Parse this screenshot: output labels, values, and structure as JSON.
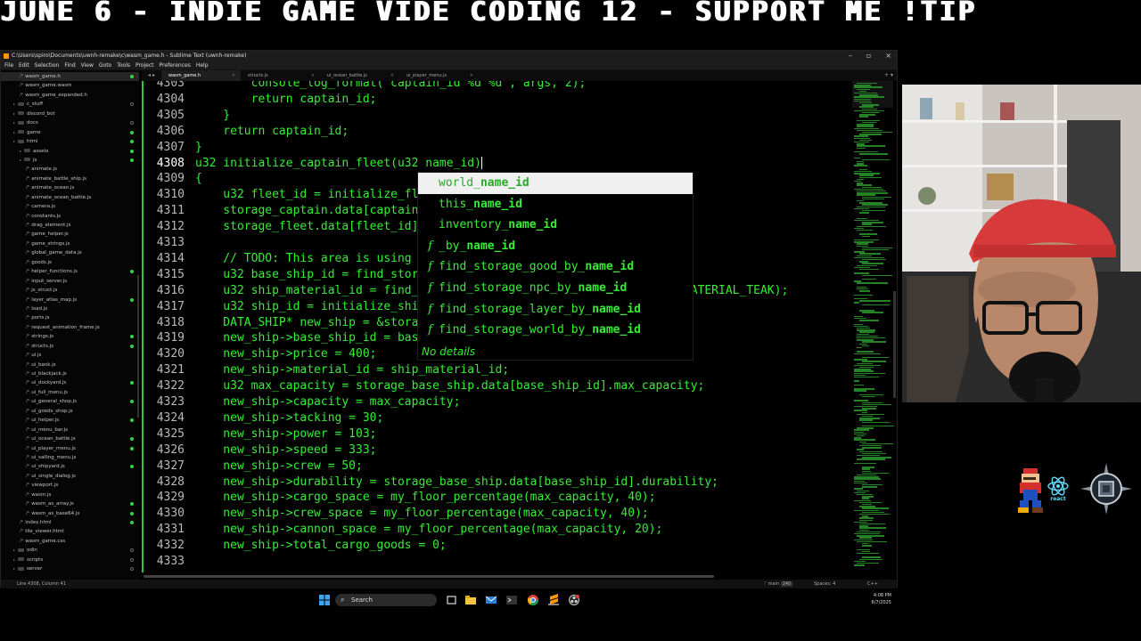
{
  "banner": {
    "text": "JUNE 6 - INDIE GAME VIDE CODING 12 - SUPPORT ME !TIP"
  },
  "window": {
    "title": "C:\\Users\\spiro\\Documents\\uwnh-remake\\c\\wasm_game.h - Sublime Text (uwnh-remake)",
    "controls": [
      "–",
      "▫",
      "×"
    ]
  },
  "menu": [
    "File",
    "Edit",
    "Selection",
    "Find",
    "View",
    "Goto",
    "Tools",
    "Project",
    "Preferences",
    "Help"
  ],
  "sidebar": {
    "items": [
      {
        "label": "wasm_game.h",
        "type": "file",
        "depth": 3,
        "status": "mod",
        "selected": true
      },
      {
        "label": "wasm_game.wasm",
        "type": "file",
        "depth": 3,
        "status": "none"
      },
      {
        "label": "wasm_game_expanded.h",
        "type": "file",
        "depth": 3,
        "status": "none"
      },
      {
        "label": "c_stuff",
        "type": "folder",
        "depth": 2,
        "status": "empty"
      },
      {
        "label": "discord_bot",
        "type": "folder",
        "depth": 2,
        "status": "none"
      },
      {
        "label": "docs",
        "type": "folder",
        "depth": 2,
        "status": "empty"
      },
      {
        "label": "game",
        "type": "folder",
        "depth": 2,
        "status": "mod"
      },
      {
        "label": "html",
        "type": "folder",
        "depth": 2,
        "status": "mod"
      },
      {
        "label": "assets",
        "type": "folder",
        "depth": 3,
        "status": "mod"
      },
      {
        "label": "js",
        "type": "folder",
        "depth": 3,
        "status": "mod"
      },
      {
        "label": "animate.js",
        "type": "file",
        "depth": 4,
        "status": "none"
      },
      {
        "label": "animate_battle_ship.js",
        "type": "file",
        "depth": 4,
        "status": "none"
      },
      {
        "label": "animate_ocean.js",
        "type": "file",
        "depth": 4,
        "status": "none"
      },
      {
        "label": "animate_ocean_battle.js",
        "type": "file",
        "depth": 4,
        "status": "none"
      },
      {
        "label": "camera.js",
        "type": "file",
        "depth": 4,
        "status": "none"
      },
      {
        "label": "constants.js",
        "type": "file",
        "depth": 4,
        "status": "none"
      },
      {
        "label": "drag_element.js",
        "type": "file",
        "depth": 4,
        "status": "none"
      },
      {
        "label": "game_helper.js",
        "type": "file",
        "depth": 4,
        "status": "none"
      },
      {
        "label": "game_strings.js",
        "type": "file",
        "depth": 4,
        "status": "none"
      },
      {
        "label": "global_game_data.js",
        "type": "file",
        "depth": 4,
        "status": "none"
      },
      {
        "label": "goods.js",
        "type": "file",
        "depth": 4,
        "status": "none"
      },
      {
        "label": "helper_functions.js",
        "type": "file",
        "depth": 4,
        "status": "mod"
      },
      {
        "label": "input_server.js",
        "type": "file",
        "depth": 4,
        "status": "none"
      },
      {
        "label": "js_struct.js",
        "type": "file",
        "depth": 4,
        "status": "none"
      },
      {
        "label": "layer_atlas_map.js",
        "type": "file",
        "depth": 4,
        "status": "mod"
      },
      {
        "label": "load.js",
        "type": "file",
        "depth": 4,
        "status": "none"
      },
      {
        "label": "ports.js",
        "type": "file",
        "depth": 4,
        "status": "none"
      },
      {
        "label": "request_animation_frame.js",
        "type": "file",
        "depth": 4,
        "status": "none"
      },
      {
        "label": "strings.js",
        "type": "file",
        "depth": 4,
        "status": "mod"
      },
      {
        "label": "structs.js",
        "type": "file",
        "depth": 4,
        "status": "mod"
      },
      {
        "label": "ui.js",
        "type": "file",
        "depth": 4,
        "status": "none"
      },
      {
        "label": "ui_bank.js",
        "type": "file",
        "depth": 4,
        "status": "none"
      },
      {
        "label": "ui_blackjack.js",
        "type": "file",
        "depth": 4,
        "status": "none"
      },
      {
        "label": "ui_dockyard.js",
        "type": "file",
        "depth": 4,
        "status": "mod"
      },
      {
        "label": "ui_full_menu.js",
        "type": "file",
        "depth": 4,
        "status": "none"
      },
      {
        "label": "ui_general_shop.js",
        "type": "file",
        "depth": 4,
        "status": "mod"
      },
      {
        "label": "ui_goods_shop.js",
        "type": "file",
        "depth": 4,
        "status": "none"
      },
      {
        "label": "ui_helper.js",
        "type": "file",
        "depth": 4,
        "status": "mod"
      },
      {
        "label": "ui_menu_bar.js",
        "type": "file",
        "depth": 4,
        "status": "none"
      },
      {
        "label": "ui_ocean_battle.js",
        "type": "file",
        "depth": 4,
        "status": "mod"
      },
      {
        "label": "ui_player_menu.js",
        "type": "file",
        "depth": 4,
        "status": "mod"
      },
      {
        "label": "ui_sailing_menu.js",
        "type": "file",
        "depth": 4,
        "status": "none"
      },
      {
        "label": "ui_shipyard.js",
        "type": "file",
        "depth": 4,
        "status": "mod"
      },
      {
        "label": "ui_single_dialog.js",
        "type": "file",
        "depth": 4,
        "status": "none"
      },
      {
        "label": "viewport.js",
        "type": "file",
        "depth": 4,
        "status": "none"
      },
      {
        "label": "wasm.js",
        "type": "file",
        "depth": 4,
        "status": "none"
      },
      {
        "label": "wasm_as_array.js",
        "type": "file",
        "depth": 4,
        "status": "mod"
      },
      {
        "label": "wasm_as_base64.js",
        "type": "file",
        "depth": 4,
        "status": "mod"
      },
      {
        "label": "index.html",
        "type": "file",
        "depth": 3,
        "status": "mod"
      },
      {
        "label": "tile_viewer.html",
        "type": "file",
        "depth": 3,
        "status": "none"
      },
      {
        "label": "wasm_game.css",
        "type": "file",
        "depth": 3,
        "status": "none"
      },
      {
        "label": "odin",
        "type": "folder",
        "depth": 2,
        "status": "empty"
      },
      {
        "label": "scripts",
        "type": "folder",
        "depth": 2,
        "status": "empty"
      },
      {
        "label": "server",
        "type": "folder",
        "depth": 2,
        "status": "empty"
      }
    ]
  },
  "tabs": {
    "items": [
      {
        "label": "wasm_game.h",
        "active": true
      },
      {
        "label": "structs.js",
        "active": false
      },
      {
        "label": "ui_ocean_battle.js",
        "active": false
      },
      {
        "label": "ui_player_menu.js",
        "active": false
      }
    ]
  },
  "code": {
    "lines": [
      {
        "n": "4303",
        "text": "        console_log_format(\"captain_id %d %d\", args, 2);",
        "y": -6
      },
      {
        "n": "4304",
        "text": "        return captain_id;"
      },
      {
        "n": "4305",
        "text": "    }"
      },
      {
        "n": "4306",
        "text": "    return captain_id;"
      },
      {
        "n": "4307",
        "text": "}"
      },
      {
        "n": "4308",
        "text": "u32 initialize_captain_fleet(u32 name_id)",
        "current": true
      },
      {
        "n": "4309",
        "text": "{"
      },
      {
        "n": "4310",
        "text": "    u32 fleet_id = initialize_fleet();"
      },
      {
        "n": "4311",
        "text": "    storage_captain.data[captain_id].fleet_id = fleet_id;"
      },
      {
        "n": "4312",
        "text": "    storage_fleet.data[fleet_id].captain_id = captain_id;"
      },
      {
        "n": "4313",
        "text": ""
      },
      {
        "n": "4314",
        "text": "    // TODO: This area is using"
      },
      {
        "n": "4315",
        "text": "    u32 base_ship_id = find_storage_base_ship_by_name_id(SHIP_BALSA);"
      },
      {
        "n": "4316",
        "text": "    u32 ship_material_id = find_storage_ship_material_by_name_id(SHIP_MATERIAL_TEAK);"
      },
      {
        "n": "4317",
        "text": "    u32 ship_id = initialize_ship();"
      },
      {
        "n": "4318",
        "text": "    DATA_SHIP* new_ship = &storage_ship.data[ship_id];"
      },
      {
        "n": "4319",
        "text": "    new_ship->base_ship_id = base_ship_id;"
      },
      {
        "n": "4320",
        "text": "    new_ship->price = 400;"
      },
      {
        "n": "4321",
        "text": "    new_ship->material_id = ship_material_id;"
      },
      {
        "n": "4322",
        "text": "    u32 max_capacity = storage_base_ship.data[base_ship_id].max_capacity;"
      },
      {
        "n": "4323",
        "text": "    new_ship->capacity = max_capacity;"
      },
      {
        "n": "4324",
        "text": "    new_ship->tacking = 30;"
      },
      {
        "n": "4325",
        "text": "    new_ship->power = 103;"
      },
      {
        "n": "4326",
        "text": "    new_ship->speed = 333;"
      },
      {
        "n": "4327",
        "text": "    new_ship->crew = 50;"
      },
      {
        "n": "4328",
        "text": "    new_ship->durability = storage_base_ship.data[base_ship_id].durability;"
      },
      {
        "n": "4329",
        "text": "    new_ship->cargo_space = my_floor_percentage(max_capacity, 40);"
      },
      {
        "n": "4330",
        "text": "    new_ship->crew_space = my_floor_percentage(max_capacity, 40);"
      },
      {
        "n": "4331",
        "text": "    new_ship->cannon_space = my_floor_percentage(max_capacity, 20);"
      },
      {
        "n": "4332",
        "text": "    new_ship->total_cargo_goods = 0;"
      },
      {
        "n": "4333",
        "text": ""
      }
    ]
  },
  "autocomplete": {
    "items": [
      {
        "prefix": "world_",
        "match": "name_id",
        "kind": "",
        "selected": true
      },
      {
        "prefix": "this_",
        "match": "name_id",
        "kind": ""
      },
      {
        "prefix": "inventory_",
        "match": "name_id",
        "kind": ""
      },
      {
        "prefix": "_by_",
        "match": "name_id",
        "kind": "f"
      },
      {
        "prefix": "find_storage_good_by_",
        "match": "name_id",
        "kind": "f"
      },
      {
        "prefix": "find_storage_npc_by_",
        "match": "name_id",
        "kind": "f"
      },
      {
        "prefix": "find_storage_layer_by_",
        "match": "name_id",
        "kind": "f"
      },
      {
        "prefix": "find_storage_world_by_",
        "match": "name_id",
        "kind": "f"
      }
    ],
    "details": "No details"
  },
  "statusbar": {
    "position": "Line 4308, Column 41",
    "branch": "main",
    "branch_count": "240",
    "spaces": "Spaces: 4",
    "language": "C++"
  },
  "taskbar": {
    "search_placeholder": "Search",
    "time": "4:08 PM",
    "date": "6/7/2025"
  },
  "webcam": {
    "description": ""
  },
  "logos": [
    "react"
  ]
}
